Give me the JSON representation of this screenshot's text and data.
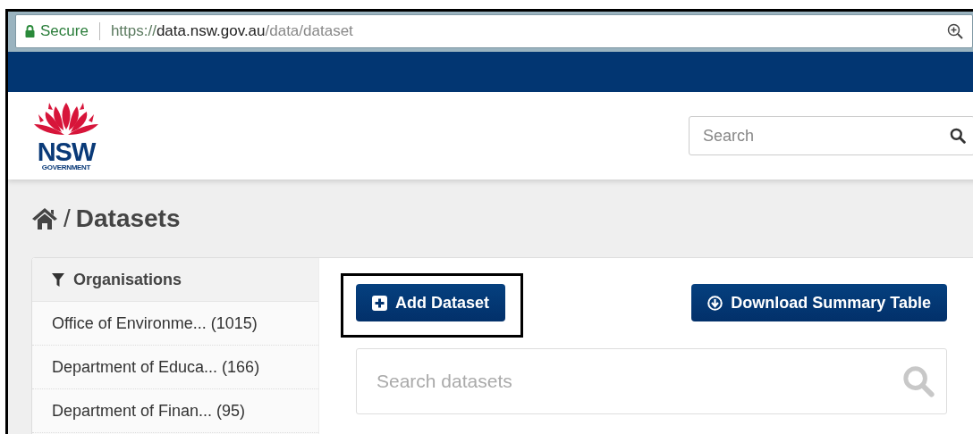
{
  "browser": {
    "security": "Secure",
    "url": {
      "scheme": "https://",
      "host": "data.nsw.gov.au",
      "path": "/data/dataset"
    }
  },
  "header": {
    "logo": {
      "name": "NSW",
      "subtitle": "GOVERNMENT"
    },
    "search": {
      "placeholder": "Search"
    }
  },
  "breadcrumb": {
    "separator": "/",
    "title": "Datasets"
  },
  "sidebar": {
    "title": "Organisations",
    "items": [
      {
        "label": "Office of Environme... (1015)"
      },
      {
        "label": "Department of Educa... (166)"
      },
      {
        "label": "Department of Finan... (95)"
      }
    ]
  },
  "content": {
    "add_button": {
      "label": "Add Dataset",
      "highlighted": true
    },
    "download_button": {
      "label": "Download Summary Table"
    },
    "search": {
      "placeholder": "Search datasets"
    }
  }
}
